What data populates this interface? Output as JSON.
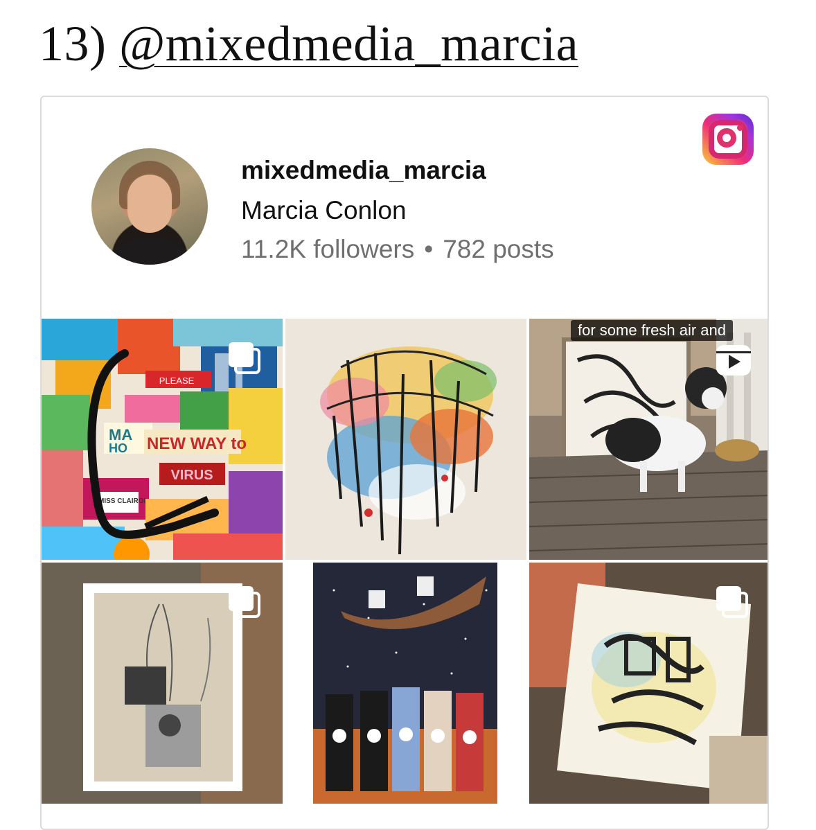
{
  "heading": {
    "number": "13)",
    "handle": "@mixedmedia_marcia"
  },
  "profile": {
    "username": "mixedmedia_marcia",
    "full_name": "Marcia Conlon",
    "followers": "11.2K followers",
    "separator": "•",
    "posts": "782 posts"
  },
  "brand": {
    "icon": "instagram-logo-icon",
    "gradient": [
      "#f9ce34",
      "#ee2a7b",
      "#6228d7"
    ]
  },
  "posts": [
    {
      "type": "carousel",
      "icon": "carousel-icon"
    },
    {
      "type": "image"
    },
    {
      "type": "reel",
      "icon": "reel-icon",
      "overlay_text": "for some fresh air and"
    },
    {
      "type": "carousel",
      "icon": "carousel-icon"
    },
    {
      "type": "image"
    },
    {
      "type": "carousel",
      "icon": "carousel-icon"
    }
  ],
  "collage_text": {
    "please": "PLEASE",
    "new_way": "NEW WAY to",
    "virus": "VIRUS",
    "miss_clairol": "MISS CLAIROL",
    "ma": "MA",
    "ho": "HO"
  }
}
